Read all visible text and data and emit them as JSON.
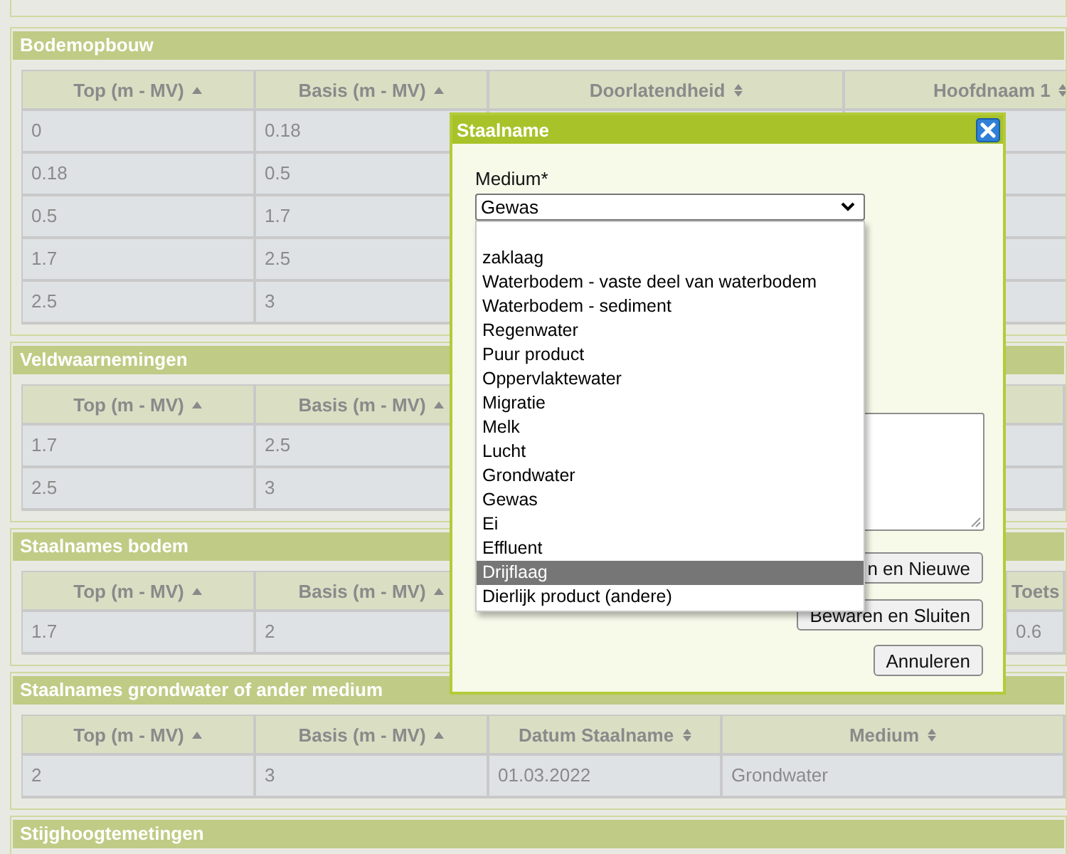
{
  "sections": [
    {
      "title": "Bodemopbouw",
      "columns": [
        {
          "label": "Top (m - MV)",
          "sorted": true
        },
        {
          "label": "Basis (m - MV)",
          "sorted": true
        },
        {
          "label": "Doorlatendheid",
          "sorted": false
        },
        {
          "label": "Hoofdnaam 1",
          "sorted": false
        }
      ],
      "rows": [
        [
          "0",
          "0.18"
        ],
        [
          "0.18",
          "0.5"
        ],
        [
          "0.5",
          "1.7"
        ],
        [
          "1.7",
          "2.5"
        ],
        [
          "2.5",
          "3"
        ]
      ]
    },
    {
      "title": "Veldwaarnemingen",
      "columns": [
        {
          "label": "Top (m - MV)",
          "sorted": true
        },
        {
          "label": "Basis (m - MV)",
          "sorted": true
        }
      ],
      "rows": [
        [
          "1.7",
          "2.5"
        ],
        [
          "2.5",
          "3"
        ]
      ]
    },
    {
      "title": "Staalnames bodem",
      "columns": [
        {
          "label": "Top (m - MV)",
          "sorted": true
        },
        {
          "label": "Basis (m - MV)",
          "sorted": true
        },
        {
          "label": "Toets"
        }
      ],
      "rows": [
        [
          "1.7",
          "2",
          "0.6"
        ]
      ]
    },
    {
      "title": "Staalnames grondwater of ander medium",
      "columns": [
        {
          "label": "Top (m - MV)",
          "sorted": true
        },
        {
          "label": "Basis (m - MV)",
          "sorted": true
        },
        {
          "label": "Datum Staalname",
          "sorted": false
        },
        {
          "label": "Medium",
          "sorted": false
        }
      ],
      "rows": [
        [
          "2",
          "3",
          "01.03.2022",
          "Grondwater"
        ]
      ]
    },
    {
      "title": "Stijghoogtemetingen"
    }
  ],
  "dialog": {
    "title": "Staalname",
    "medium_label": "Medium*",
    "medium_value": "Gewas",
    "options": [
      {
        "label": "zaklaag",
        "selected": false
      },
      {
        "label": "Waterbodem - vaste deel van waterbodem",
        "selected": false
      },
      {
        "label": "Waterbodem - sediment",
        "selected": false
      },
      {
        "label": "Regenwater",
        "selected": false
      },
      {
        "label": "Puur product",
        "selected": false
      },
      {
        "label": "Oppervlaktewater",
        "selected": false
      },
      {
        "label": "Migratie",
        "selected": false
      },
      {
        "label": "Melk",
        "selected": false
      },
      {
        "label": "Lucht",
        "selected": false
      },
      {
        "label": "Grondwater",
        "selected": false
      },
      {
        "label": "Gewas",
        "selected": false
      },
      {
        "label": "Ei",
        "selected": false
      },
      {
        "label": "Effluent",
        "selected": false
      },
      {
        "label": "Drijflaag",
        "selected": true
      },
      {
        "label": "Dierlijk product (andere)",
        "selected": false
      }
    ],
    "buttons": [
      "n en Nieuwe",
      "Bewaren en Sluiten",
      "Annuleren"
    ]
  }
}
